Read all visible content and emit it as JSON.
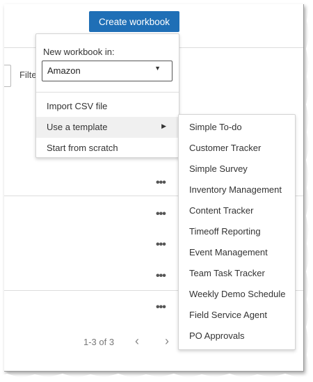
{
  "toolbar": {
    "create_workbook": "Create workbook"
  },
  "filter": {
    "label": "Filte"
  },
  "menu": {
    "new_in_label": "New workbook in:",
    "selected_account": "Amazon",
    "items": [
      {
        "label": "Import CSV file"
      },
      {
        "label": "Use a template"
      },
      {
        "label": "Start from scratch"
      }
    ]
  },
  "templates": [
    "Simple To-do",
    "Customer Tracker",
    "Simple Survey",
    "Inventory Management",
    "Content Tracker",
    "Timeoff Reporting",
    "Event Management",
    "Team Task Tracker",
    "Weekly Demo Schedule",
    "Field Service Agent",
    "PO Approvals"
  ],
  "rows": {
    "more_label": "•••"
  },
  "pagination": {
    "range": "1-3 of 3",
    "prev": "‹",
    "next": "›"
  },
  "colors": {
    "primary": "#1f6fb6",
    "hover": "#f0f0f0"
  },
  "icons": {
    "select_caret": "caret-down-icon",
    "submenu_caret": "caret-right-icon",
    "row_menu": "more-horizontal-icon"
  }
}
